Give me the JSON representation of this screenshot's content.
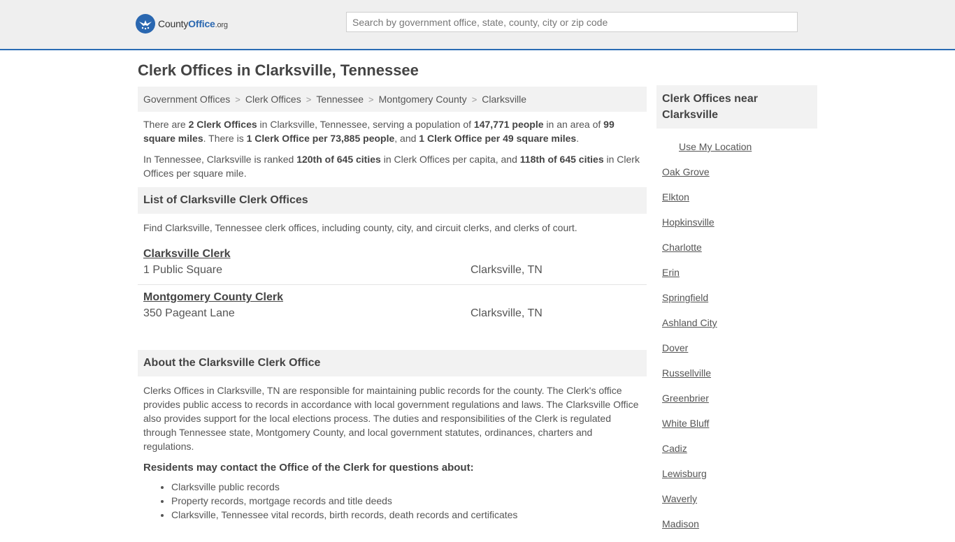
{
  "header": {
    "logo": {
      "county": "County",
      "office": "Office",
      "org": ".org"
    },
    "search_placeholder": "Search by government office, state, county, city or zip code"
  },
  "page_title": "Clerk Offices in Clarksville, Tennessee",
  "breadcrumb": [
    "Government Offices",
    "Clerk Offices",
    "Tennessee",
    "Montgomery County",
    "Clarksville"
  ],
  "intro": {
    "p1": {
      "t1": "There are ",
      "b1": "2 Clerk Offices",
      "t2": " in Clarksville, Tennessee, serving a population of ",
      "b2": "147,771 people",
      "t3": " in an area of ",
      "b3": "99 square miles",
      "t4": ". There is ",
      "b4": "1 Clerk Office per 73,885 people",
      "t5": ", and ",
      "b5": "1 Clerk Office per 49 square miles",
      "t6": "."
    },
    "p2": {
      "t1": "In Tennessee, Clarksville is ranked ",
      "b1": "120th of 645 cities",
      "t2": " in Clerk Offices per capita, and ",
      "b2": "118th of 645 cities",
      "t3": " in Clerk Offices per square mile."
    }
  },
  "list": {
    "heading": "List of Clarksville Clerk Offices",
    "description": "Find Clarksville, Tennessee clerk offices, including county, city, and circuit clerks, and clerks of court.",
    "offices": [
      {
        "name": "Clarksville Clerk",
        "address": "1 Public Square",
        "city": "Clarksville, TN"
      },
      {
        "name": "Montgomery County Clerk",
        "address": "350 Pageant Lane",
        "city": "Clarksville, TN"
      }
    ]
  },
  "about": {
    "heading": "About the Clarksville Clerk Office",
    "body": "Clerks Offices in Clarksville, TN are responsible for maintaining public records for the county. The Clerk's office provides public access to records in accordance with local government regulations and laws. The Clarksville Office also provides support for the local elections process. The duties and responsibilities of the Clerk is regulated through Tennessee state, Montgomery County, and local government statutes, ordinances, charters and regulations.",
    "subheading": "Residents may contact the Office of the Clerk for questions about:",
    "items": [
      "Clarksville public records",
      "Property records, mortgage records and title deeds",
      "Clarksville, Tennessee vital records, birth records, death records and certificates"
    ]
  },
  "sidebar": {
    "heading": "Clerk Offices near Clarksville",
    "use_location": "Use My Location",
    "cities": [
      "Oak Grove",
      "Elkton",
      "Hopkinsville",
      "Charlotte",
      "Erin",
      "Springfield",
      "Ashland City",
      "Dover",
      "Russellville",
      "Greenbrier",
      "White Bluff",
      "Cadiz",
      "Lewisburg",
      "Waverly",
      "Madison"
    ]
  }
}
